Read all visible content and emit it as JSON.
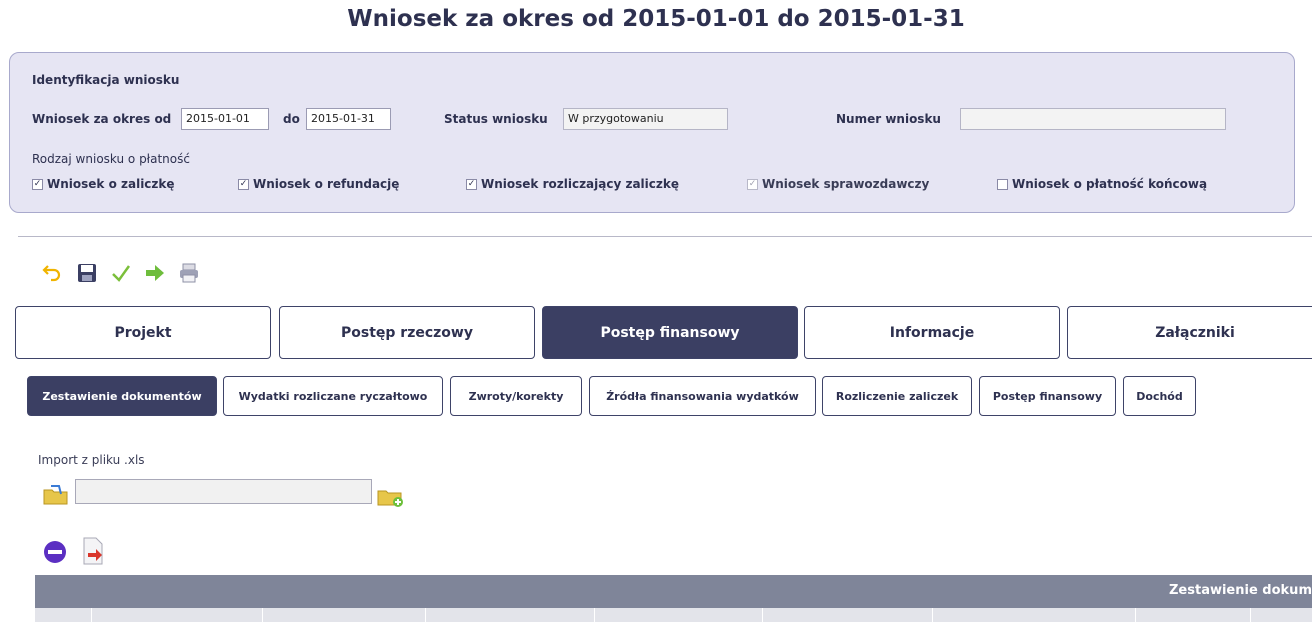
{
  "page_title": "Wniosek za okres od 2015-01-01 do 2015-01-31",
  "identification": {
    "heading": "Identyfikacja wniosku",
    "period_from_label": "Wniosek za okres od",
    "period_from_value": "2015-01-01",
    "period_to_label": "do",
    "period_to_value": "2015-01-31",
    "status_label": "Status wniosku",
    "status_value": "W przygotowaniu",
    "number_label": "Numer wniosku",
    "number_value": "",
    "type_label": "Rodzaj wniosku o płatność",
    "checkboxes": [
      {
        "label": "Wniosek o zaliczkę",
        "checked": true
      },
      {
        "label": "Wniosek o refundację",
        "checked": true
      },
      {
        "label": "Wniosek rozliczający zaliczkę",
        "checked": true
      },
      {
        "label": "Wniosek sprawozdawczy",
        "checked": true
      },
      {
        "label": "Wniosek o płatność końcową",
        "checked": false
      }
    ]
  },
  "toolbar": {
    "icons": [
      "undo-icon",
      "save-icon",
      "check-icon",
      "submit-arrow-icon",
      "print-icon"
    ]
  },
  "main_tabs": [
    {
      "label": "Projekt",
      "active": false
    },
    {
      "label": "Postęp rzeczowy",
      "active": false
    },
    {
      "label": "Postęp finansowy",
      "active": true
    },
    {
      "label": "Informacje",
      "active": false
    },
    {
      "label": "Załączniki",
      "active": false
    }
  ],
  "sub_tabs": [
    {
      "label": "Zestawienie dokumentów",
      "active": true
    },
    {
      "label": "Wydatki rozliczane ryczałtowo",
      "active": false
    },
    {
      "label": "Zwroty/korekty",
      "active": false
    },
    {
      "label": "Źródła finansowania wydatków",
      "active": false
    },
    {
      "label": "Rozliczenie zaliczek",
      "active": false
    },
    {
      "label": "Postęp finansowy",
      "active": false
    },
    {
      "label": "Dochód",
      "active": false
    }
  ],
  "import": {
    "label": "Import z pliku .xls",
    "value": ""
  },
  "table": {
    "caption": "Zestawienie dokum"
  },
  "colors": {
    "accent": "#3b3f63",
    "panel_bg": "#e6e5f3",
    "table_header": "#7f8599"
  }
}
